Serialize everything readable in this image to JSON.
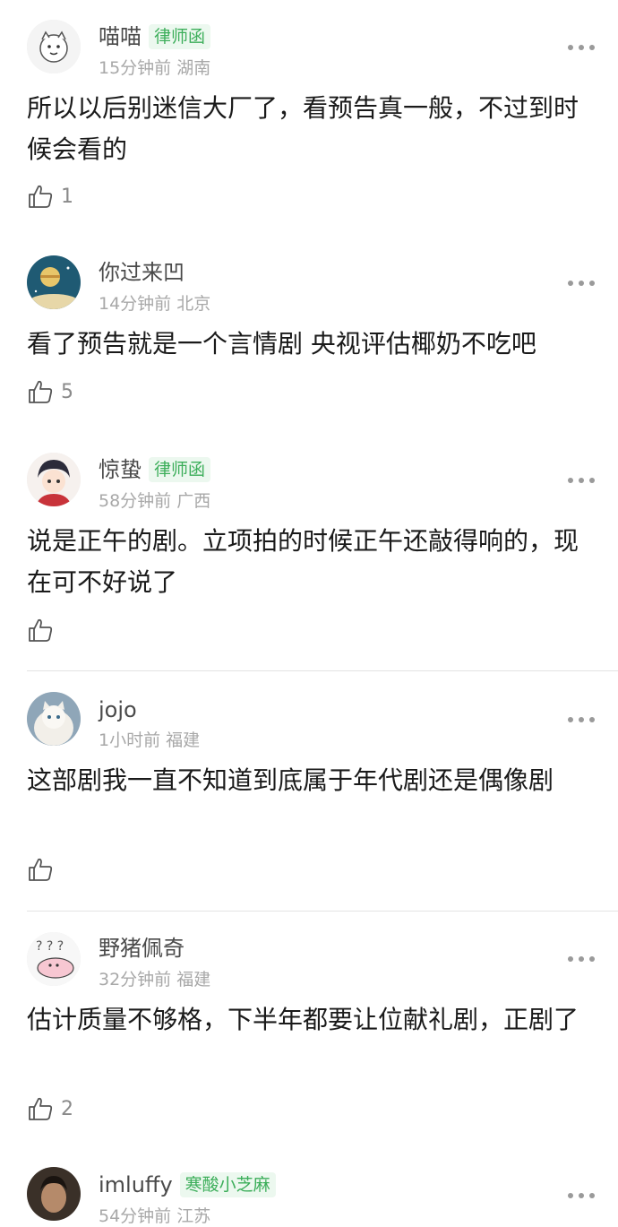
{
  "comments": [
    {
      "user": "喵喵",
      "badge": "律师函",
      "time": "15分钟前",
      "location": "湖南",
      "text": "所以以后别迷信大厂了，看预告真一般，不过到时候会看的",
      "likes": "1",
      "avatar": "cartoon-cat-avatar"
    },
    {
      "user": "你过来凹",
      "badge": "",
      "time": "14分钟前",
      "location": "北京",
      "text": "看了预告就是一个言情剧 央视评估椰奶不吃吧",
      "likes": "5",
      "avatar": "night-planet-avatar"
    },
    {
      "user": "惊蛰",
      "badge": "律师函",
      "time": "58分钟前",
      "location": "广西",
      "text": "说是正午的剧。立项拍的时候正午还敲得响的，现在可不好说了",
      "likes": "",
      "avatar": "anime-boy-avatar"
    },
    {
      "user": "jojo",
      "badge": "",
      "time": "1小时前",
      "location": "福建",
      "text": "这部剧我一直不知道到底属于年代剧还是偶像剧",
      "likes": "",
      "avatar": "white-cat-avatar"
    },
    {
      "user": "野猪佩奇",
      "badge": "",
      "time": "32分钟前",
      "location": "福建",
      "text": "估计质量不够格，下半年都要让位献礼剧，正剧了",
      "likes": "2",
      "avatar": "pink-cartoon-avatar"
    },
    {
      "user": "imluffy",
      "badge": "寒酸小芝麻",
      "time": "54分钟前",
      "location": "江苏",
      "text": "",
      "likes": "",
      "avatar": "man-photo-avatar"
    }
  ],
  "colors": {
    "badge_text": "#3cae5a",
    "badge_bg": "#ecf8ef",
    "meta": "#a8a8a8",
    "name": "#4a4a4a"
  }
}
